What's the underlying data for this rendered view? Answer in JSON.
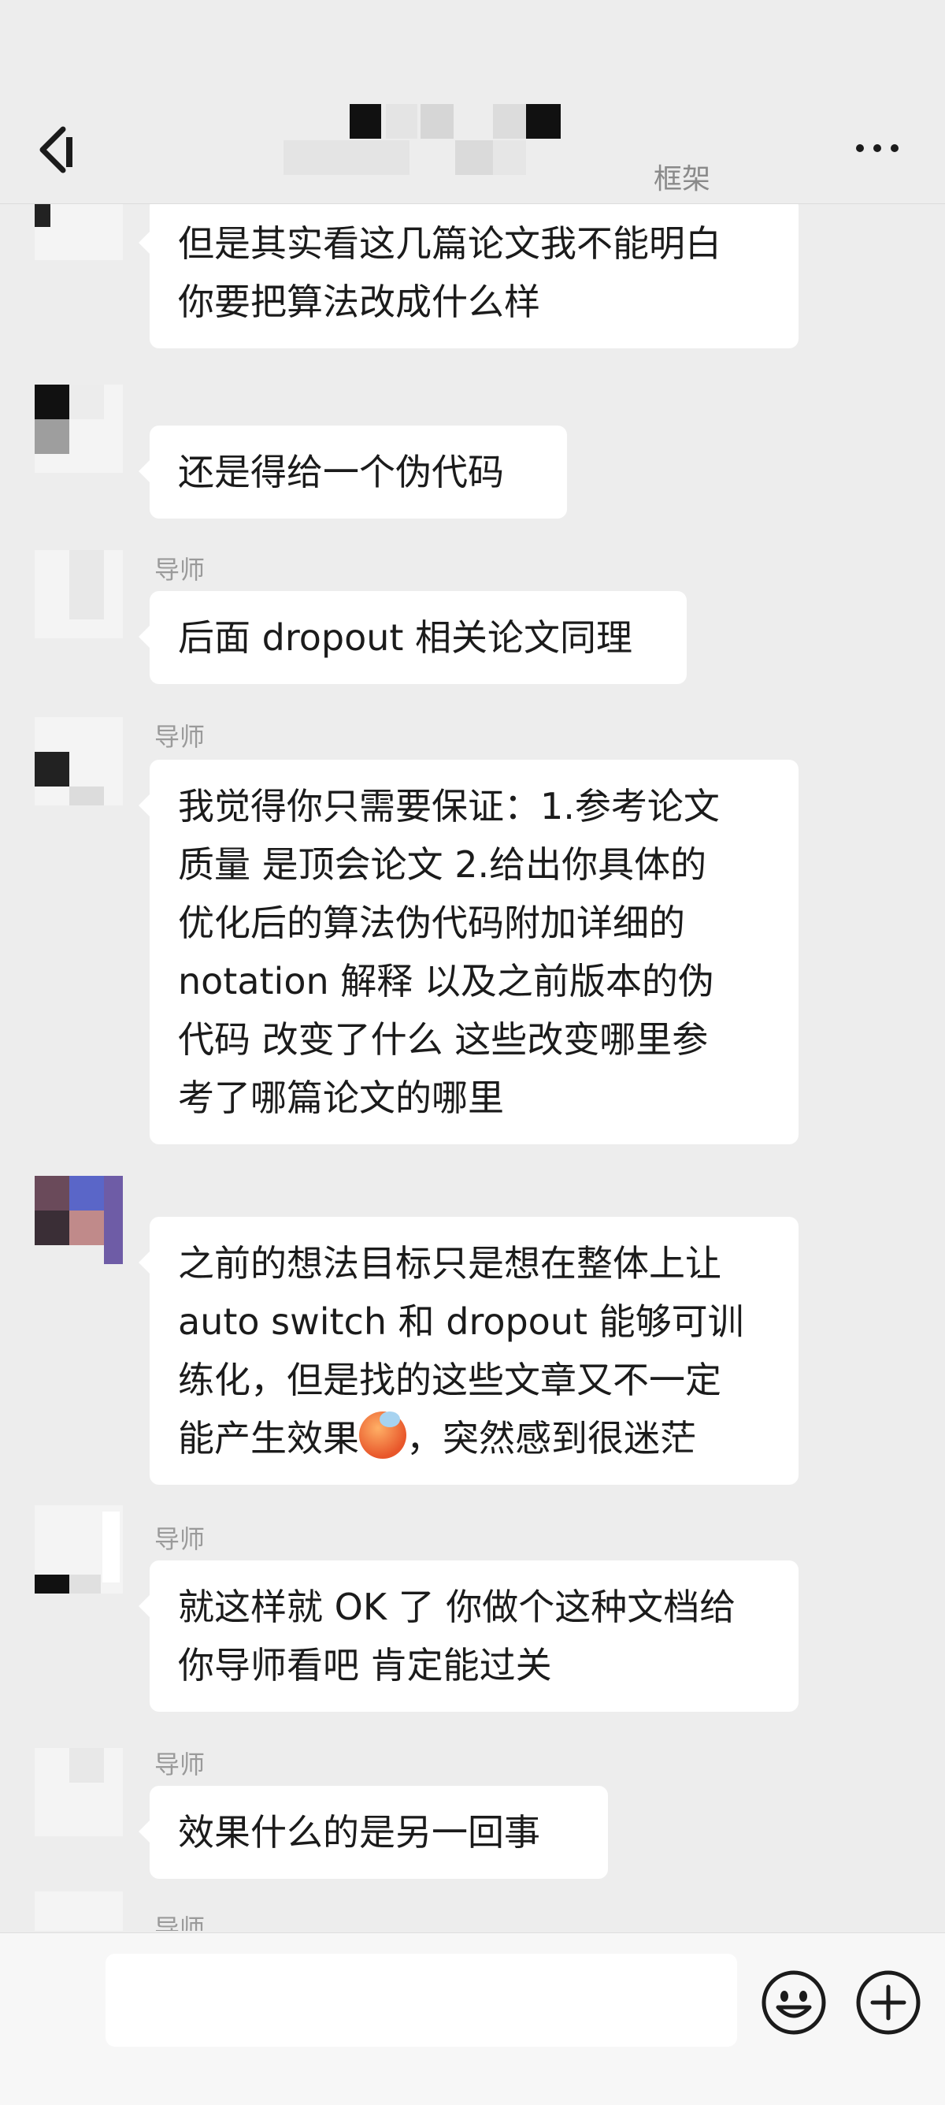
{
  "header": {
    "subtitle": "框架",
    "back_icon": "chevron-left-icon",
    "more_icon": "more-dots-icon"
  },
  "messages": [
    {
      "sender": "",
      "lines": [
        "但是其实看这几篇论文我不能明白",
        "你要把算法改成什么样"
      ]
    },
    {
      "sender": "",
      "lines": [
        "还是得给一个伪代码"
      ]
    },
    {
      "sender": "导师",
      "lines": [
        "后面 dropout 相关论文同理"
      ]
    },
    {
      "sender": "导师",
      "lines": [
        "我觉得你只需要保证：1.参考论文",
        "质量 是顶会论文 2.给出你具体的",
        "优化后的算法伪代码附加详细的",
        "notation 解释 以及之前版本的伪",
        "代码 改变了什么 这些改变哪里参",
        "考了哪篇论文的哪里"
      ]
    },
    {
      "sender": "",
      "lines": [
        "之前的想法目标只是想在整体上让",
        "auto switch 和 dropout 能够可训",
        "练化，但是找的这些文章又不一定",
        "能产生效果",
        "，突然感到很迷茫"
      ],
      "emoji": "overheated-face-emoji"
    },
    {
      "sender": "导师",
      "lines": [
        "就这样就 OK 了 你做个这种文档给",
        "你导师看吧 肯定能过关"
      ]
    },
    {
      "sender": "导师",
      "lines": [
        "效果什么的是另一回事"
      ]
    },
    {
      "sender": "导师",
      "lines": []
    }
  ],
  "input_bar": {
    "emoji_icon": "emoji-smile-icon",
    "plus_icon": "plus-circle-icon"
  }
}
